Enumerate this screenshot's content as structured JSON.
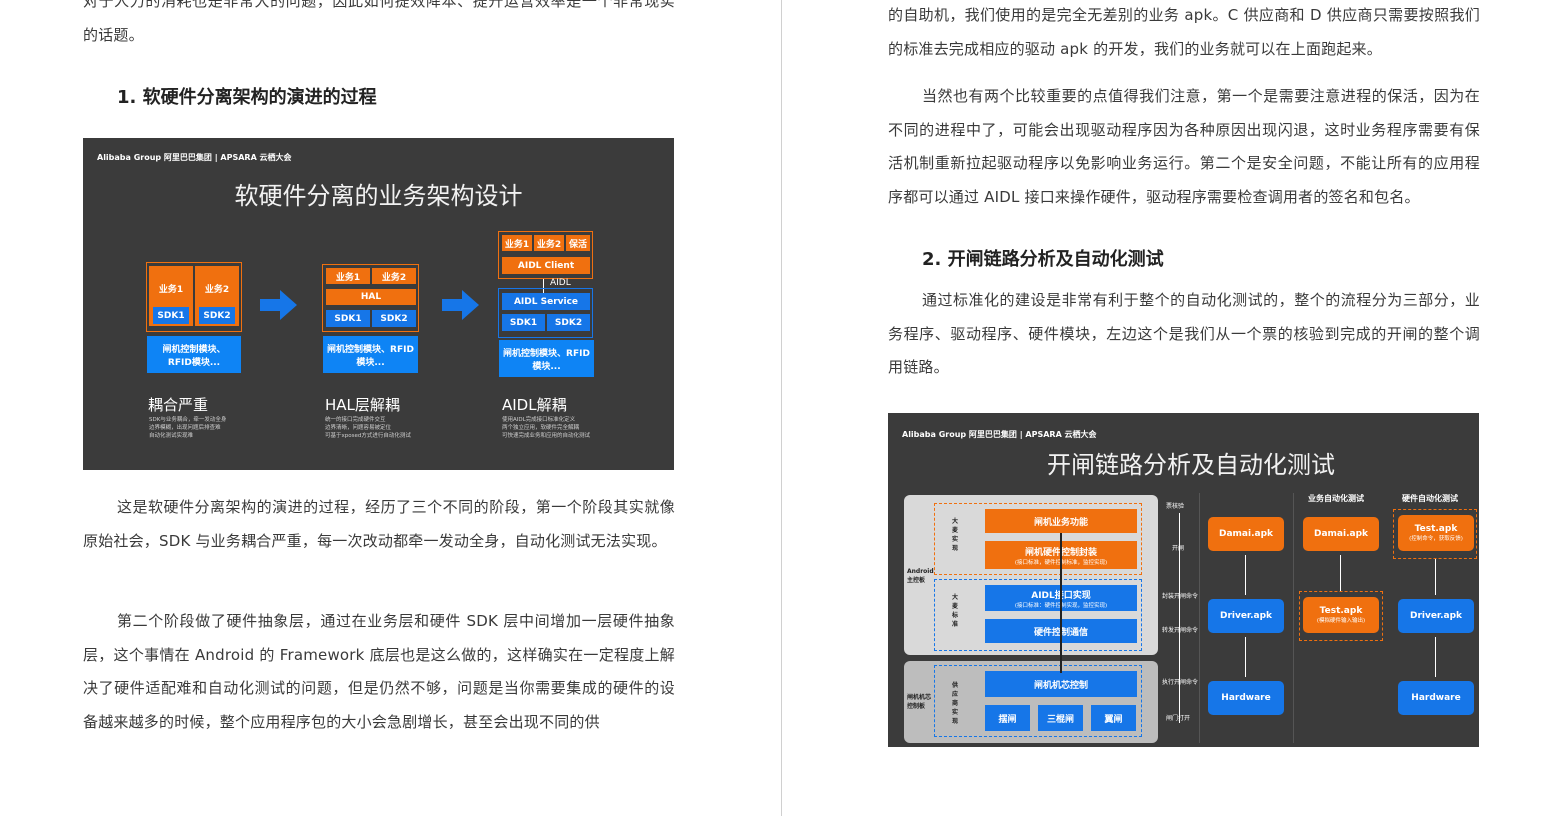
{
  "left_column": {
    "para_top": "对于人力的消耗也是非常大的问题，因此如何提效降本、提升运营效率是一个非常现实的话题。",
    "heading1": "1. 软硬件分离架构的演进的过程",
    "para1": "这是软硬件分离架构的演进的过程，经历了三个不同的阶段，第一个阶段其实就像原始社会，SDK 与业务耦合严重，每一次改动都牵一发动全身，自动化测试无法实现。",
    "para2": "第二个阶段做了硬件抽象层，通过在业务层和硬件 SDK 层中间增加一层硬件抽象层，这个事情在 Android 的 Framework 底层也是这么做的，这样确实在一定程度上解决了硬件适配难和自动化测试的问题，但是仍然不够，问题是当你需要集成的硬件的设备越来越多的时候，整个应用程序包的大小会急剧增长，甚至会出现不同的供"
  },
  "right_column": {
    "para_top": "的自助机，我们使用的是完全无差别的业务 apk。C 供应商和 D 供应商只需要按照我们的标准去完成相应的驱动 apk 的开发，我们的业务就可以在上面跑起来。",
    "para3": "当然也有两个比较重要的点值得我们注意，第一个是需要注意进程的保活，因为在不同的进程中了，可能会出现驱动程序因为各种原因出现闪退，这时业务程序需要有保活机制重新拉起驱动程序以免影响业务运行。第二个是安全问题，不能让所有的应用程序都可以通过 AIDL 接口来操作硬件，驱动程序需要检查调用者的签名和包名。",
    "heading2": "2. 开闸链路分析及自动化测试",
    "para4": "通过标准化的建设是非常有利于整个的自动化测试的，整个的流程分为三部分，业务程序、驱动程序、硬件模块，左边这个是我们从一个票的核验到完成的开闸的整个调用链路。"
  },
  "slide1": {
    "logo": "Alibaba Group 阿里巴巴集团 | APSARA 云栖大会",
    "title": "软硬件分离的业务架构设计",
    "stage1": {
      "biz1": "业务1",
      "biz2": "业务2",
      "sdk1": "SDK1",
      "sdk2": "SDK2",
      "bottom": "闸机控制模块、RFID模块...",
      "title": "耦合严重",
      "desc": [
        "SDK与业务耦合，牵一发动全身",
        "边界模糊，出现问题后排查难",
        "自动化测试实现难"
      ]
    },
    "stage2": {
      "biz1": "业务1",
      "biz2": "业务2",
      "hal": "HAL",
      "sdk1": "SDK1",
      "sdk2": "SDK2",
      "bottom": "闸机控制模块、RFID模块...",
      "title": "HAL层解耦",
      "desc": [
        "统一的接口完成硬件交互",
        "边界清晰，问题容易被定位",
        "可基于xposed方式进行自动化测试"
      ]
    },
    "stage3": {
      "biz1": "业务1",
      "biz2": "业务2",
      "keep": "保活",
      "client": "AIDL Client",
      "aidl": "AIDL",
      "service": "AIDL Service",
      "sdk1": "SDK1",
      "sdk2": "SDK2",
      "bottom": "闸机控制模块、RFID模块...",
      "title": "AIDL解耦",
      "desc": [
        "使用AIDL完成接口标准化定义",
        "两个独立应用，软硬件完全解耦",
        "可快速完成业务和应用的自动化测试"
      ]
    }
  },
  "slide2": {
    "logo": "Alibaba Group 阿里巴巴集团 | APSARA 云栖大会",
    "title": "开闸链路分析及自动化测试",
    "android_label": "Android主控板",
    "chip_label": "闸机机芯控制板",
    "damai_impl": "大麦实现",
    "damai_std": "大麦标准",
    "vendor_impl": "供应商实现",
    "boxes": {
      "biz_func": "闸机业务功能",
      "hw_wrap": "闸机硬件控制封装",
      "hw_wrap_sub": "(接口标准，硬件控制标准，监控实现)",
      "aidl_impl": "AIDL接口实现",
      "aidl_impl_sub": "(接口标准：硬件控制实现，监控实现)",
      "hw_comm": "硬件控制通信",
      "chip_ctrl": "闸机机芯控制",
      "swing": "摆闸",
      "tripod": "三棍闸",
      "wing": "翼闸"
    },
    "flow": [
      "票核验",
      "开闸",
      "封装开闸命令",
      "转发开闸命令",
      "执行开闸命令",
      "闸门打开"
    ],
    "col_headers": {
      "biz_test": "业务自动化测试",
      "hw_test": "硬件自动化测试"
    },
    "col1": [
      "Damai.apk",
      "Driver.apk",
      "Hardware"
    ],
    "col2": {
      "top": "Damai.apk",
      "mid": "Test.apk",
      "mid_sub": "(模拟硬件输入输出)"
    },
    "col3": {
      "top": "Test.apk",
      "top_sub": "(控制命令，获取反馈)",
      "mid": "Driver.apk",
      "bot": "Hardware"
    }
  }
}
